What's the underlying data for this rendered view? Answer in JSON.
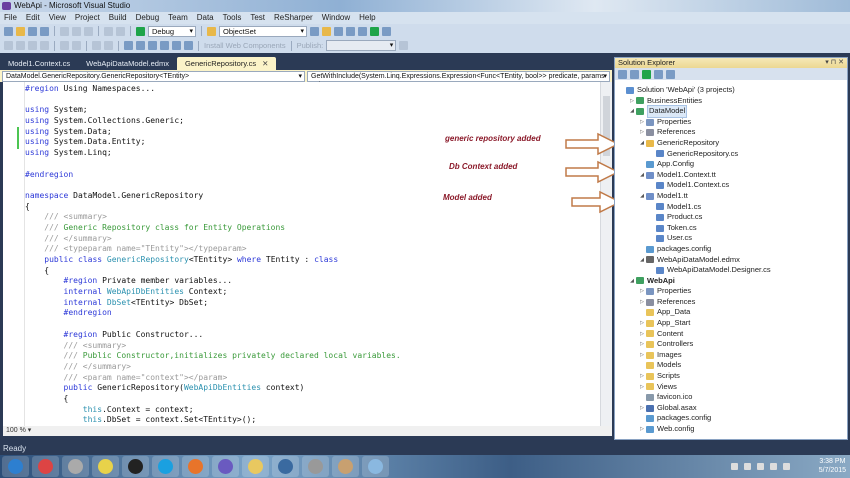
{
  "window": {
    "title": "WebApi - Microsoft Visual Studio"
  },
  "menu": [
    "File",
    "Edit",
    "View",
    "Project",
    "Build",
    "Debug",
    "Team",
    "Data",
    "Tools",
    "Test",
    "ReSharper",
    "Window",
    "Help"
  ],
  "toolbar": {
    "config": "Debug",
    "object_set": "ObjectSet",
    "install_web_components": "Install Web Components",
    "publish": "Publish:"
  },
  "tabs": [
    {
      "label": "Model1.Context.cs",
      "active": false
    },
    {
      "label": "WebApiDataModel.edmx",
      "active": false
    },
    {
      "label": "GenericRepository.cs",
      "active": true
    }
  ],
  "nav": {
    "type_combo": "DataModel.GenericRepository.GenericRepository<TEntity>",
    "member_combo": "GetWithInclude(System.Linq.Expressions.Expression<Func<TEntity, bool>> predicate, params stri"
  },
  "code_lines": [
    [
      [
        "#region",
        "pp"
      ],
      [
        " Using Namespaces...",
        ""
      ]
    ],
    [],
    [
      [
        "using",
        "kw"
      ],
      [
        " System;",
        ""
      ]
    ],
    [
      [
        "using",
        "kw"
      ],
      [
        " System.Collections.Generic;",
        ""
      ]
    ],
    [
      [
        "using",
        "kw"
      ],
      [
        " System.Data;",
        ""
      ]
    ],
    [
      [
        "using",
        "kw"
      ],
      [
        " System.Data.Entity;",
        ""
      ]
    ],
    [
      [
        "using",
        "kw"
      ],
      [
        " System.Linq;",
        ""
      ]
    ],
    [],
    [
      [
        "#endregion",
        "pp"
      ]
    ],
    [],
    [
      [
        "namespace",
        "kw"
      ],
      [
        " DataModel.GenericRepository",
        ""
      ]
    ],
    [
      [
        "{",
        ""
      ]
    ],
    [
      [
        "    /// <summary>",
        "xd"
      ]
    ],
    [
      [
        "    /// ",
        "xd"
      ],
      [
        "Generic Repository class for Entity Operations",
        "cm"
      ]
    ],
    [
      [
        "    /// </summary>",
        "xd"
      ]
    ],
    [
      [
        "    /// <typeparam name=\"TEntity\"></typeparam>",
        "xd"
      ]
    ],
    [
      [
        "    ",
        ""
      ],
      [
        "public",
        "kw"
      ],
      [
        " ",
        ""
      ],
      [
        "class",
        "kw"
      ],
      [
        " ",
        ""
      ],
      [
        "GenericRepository",
        "ty"
      ],
      [
        "<TEntity> ",
        ""
      ],
      [
        "where",
        "kw"
      ],
      [
        " TEntity : ",
        ""
      ],
      [
        "class",
        "kw"
      ]
    ],
    [
      [
        "    {",
        ""
      ]
    ],
    [
      [
        "        ",
        ""
      ],
      [
        "#region",
        "pp"
      ],
      [
        " Private member variables...",
        ""
      ]
    ],
    [
      [
        "        ",
        ""
      ],
      [
        "internal",
        "kw"
      ],
      [
        " ",
        ""
      ],
      [
        "WebApiDbEntities",
        "ty"
      ],
      [
        " Context;",
        ""
      ]
    ],
    [
      [
        "        ",
        ""
      ],
      [
        "internal",
        "kw"
      ],
      [
        " ",
        ""
      ],
      [
        "DbSet",
        "ty"
      ],
      [
        "<TEntity> DbSet;",
        ""
      ]
    ],
    [
      [
        "        ",
        ""
      ],
      [
        "#endregion",
        "pp"
      ]
    ],
    [],
    [
      [
        "        ",
        ""
      ],
      [
        "#region",
        "pp"
      ],
      [
        " Public Constructor...",
        ""
      ]
    ],
    [
      [
        "        /// <summary>",
        "xd"
      ]
    ],
    [
      [
        "        /// ",
        "xd"
      ],
      [
        "Public Constructor,initializes privately declared local variables.",
        "cm"
      ]
    ],
    [
      [
        "        /// </summary>",
        "xd"
      ]
    ],
    [
      [
        "        /// <param name=\"context\"></param>",
        "xd"
      ]
    ],
    [
      [
        "        ",
        ""
      ],
      [
        "public",
        "kw"
      ],
      [
        " GenericRepository(",
        ""
      ],
      [
        "WebApiDbEntities",
        "ty"
      ],
      [
        " context)",
        ""
      ]
    ],
    [
      [
        "        {",
        ""
      ]
    ],
    [
      [
        "            ",
        ""
      ],
      [
        "this",
        "ty"
      ],
      [
        ".Context = context;",
        ""
      ]
    ],
    [
      [
        "            ",
        ""
      ],
      [
        "this",
        "ty"
      ],
      [
        ".DbSet = context.Set<TEntity>();",
        ""
      ]
    ]
  ],
  "annotations": [
    "generic repository added",
    "Db Context added",
    "Model added"
  ],
  "zoom": "100 %",
  "solution_explorer": {
    "title": "Solution Explorer",
    "items": [
      {
        "label": "Solution 'WebApi' (3 projects)",
        "indent": 0,
        "exp": "none",
        "icon": "solution"
      },
      {
        "label": "BusinessEntities",
        "indent": 1,
        "exp": "closed",
        "icon": "project"
      },
      {
        "label": "DataModel",
        "indent": 1,
        "exp": "open",
        "icon": "project",
        "selected": true
      },
      {
        "label": "Properties",
        "indent": 2,
        "exp": "closed",
        "icon": "properties"
      },
      {
        "label": "References",
        "indent": 2,
        "exp": "closed",
        "icon": "references"
      },
      {
        "label": "GenericRepository",
        "indent": 2,
        "exp": "open",
        "icon": "folder-open"
      },
      {
        "label": "GenericRepository.cs",
        "indent": 3,
        "exp": "none",
        "icon": "cs-file"
      },
      {
        "label": "App.Config",
        "indent": 2,
        "exp": "none",
        "icon": "config"
      },
      {
        "label": "Model1.Context.tt",
        "indent": 2,
        "exp": "open",
        "icon": "tt-file"
      },
      {
        "label": "Model1.Context.cs",
        "indent": 3,
        "exp": "none",
        "icon": "cs-file"
      },
      {
        "label": "Model1.tt",
        "indent": 2,
        "exp": "open",
        "icon": "tt-file"
      },
      {
        "label": "Model1.cs",
        "indent": 3,
        "exp": "none",
        "icon": "cs-file"
      },
      {
        "label": "Product.cs",
        "indent": 3,
        "exp": "none",
        "icon": "cs-file"
      },
      {
        "label": "Token.cs",
        "indent": 3,
        "exp": "none",
        "icon": "cs-file"
      },
      {
        "label": "User.cs",
        "indent": 3,
        "exp": "none",
        "icon": "cs-file"
      },
      {
        "label": "packages.config",
        "indent": 2,
        "exp": "none",
        "icon": "config"
      },
      {
        "label": "WebApiDataModel.edmx",
        "indent": 2,
        "exp": "open",
        "icon": "edmx"
      },
      {
        "label": "WebApiDataModel.Designer.cs",
        "indent": 3,
        "exp": "none",
        "icon": "cs-file"
      },
      {
        "label": "WebApi",
        "indent": 1,
        "exp": "open",
        "icon": "project",
        "bold": true
      },
      {
        "label": "Properties",
        "indent": 2,
        "exp": "closed",
        "icon": "properties"
      },
      {
        "label": "References",
        "indent": 2,
        "exp": "closed",
        "icon": "references"
      },
      {
        "label": "App_Data",
        "indent": 2,
        "exp": "none",
        "icon": "folder"
      },
      {
        "label": "App_Start",
        "indent": 2,
        "exp": "closed",
        "icon": "folder"
      },
      {
        "label": "Content",
        "indent": 2,
        "exp": "closed",
        "icon": "folder"
      },
      {
        "label": "Controllers",
        "indent": 2,
        "exp": "closed",
        "icon": "folder"
      },
      {
        "label": "Images",
        "indent": 2,
        "exp": "closed",
        "icon": "folder"
      },
      {
        "label": "Models",
        "indent": 2,
        "exp": "none",
        "icon": "folder"
      },
      {
        "label": "Scripts",
        "indent": 2,
        "exp": "closed",
        "icon": "folder"
      },
      {
        "label": "Views",
        "indent": 2,
        "exp": "closed",
        "icon": "folder"
      },
      {
        "label": "favicon.ico",
        "indent": 2,
        "exp": "none",
        "icon": "ico"
      },
      {
        "label": "Global.asax",
        "indent": 2,
        "exp": "closed",
        "icon": "asax"
      },
      {
        "label": "packages.config",
        "indent": 2,
        "exp": "none",
        "icon": "config"
      },
      {
        "label": "Web.config",
        "indent": 2,
        "exp": "closed",
        "icon": "config"
      }
    ]
  },
  "status": "Ready",
  "taskbar": {
    "apps": [
      "start",
      "chrome",
      "app",
      "sticky-notes",
      "P",
      "S",
      "firefox",
      "vs",
      "explorer",
      "sql",
      "tools",
      "paint",
      "notepad"
    ],
    "time": "3:38 PM",
    "date": "5/7/2015"
  },
  "colors": {
    "annotation": "#8b1a2a",
    "arrow": "#c07a48",
    "keyword": "#2d39d8",
    "type": "#2b91af",
    "comment": "#3a9a3a"
  }
}
